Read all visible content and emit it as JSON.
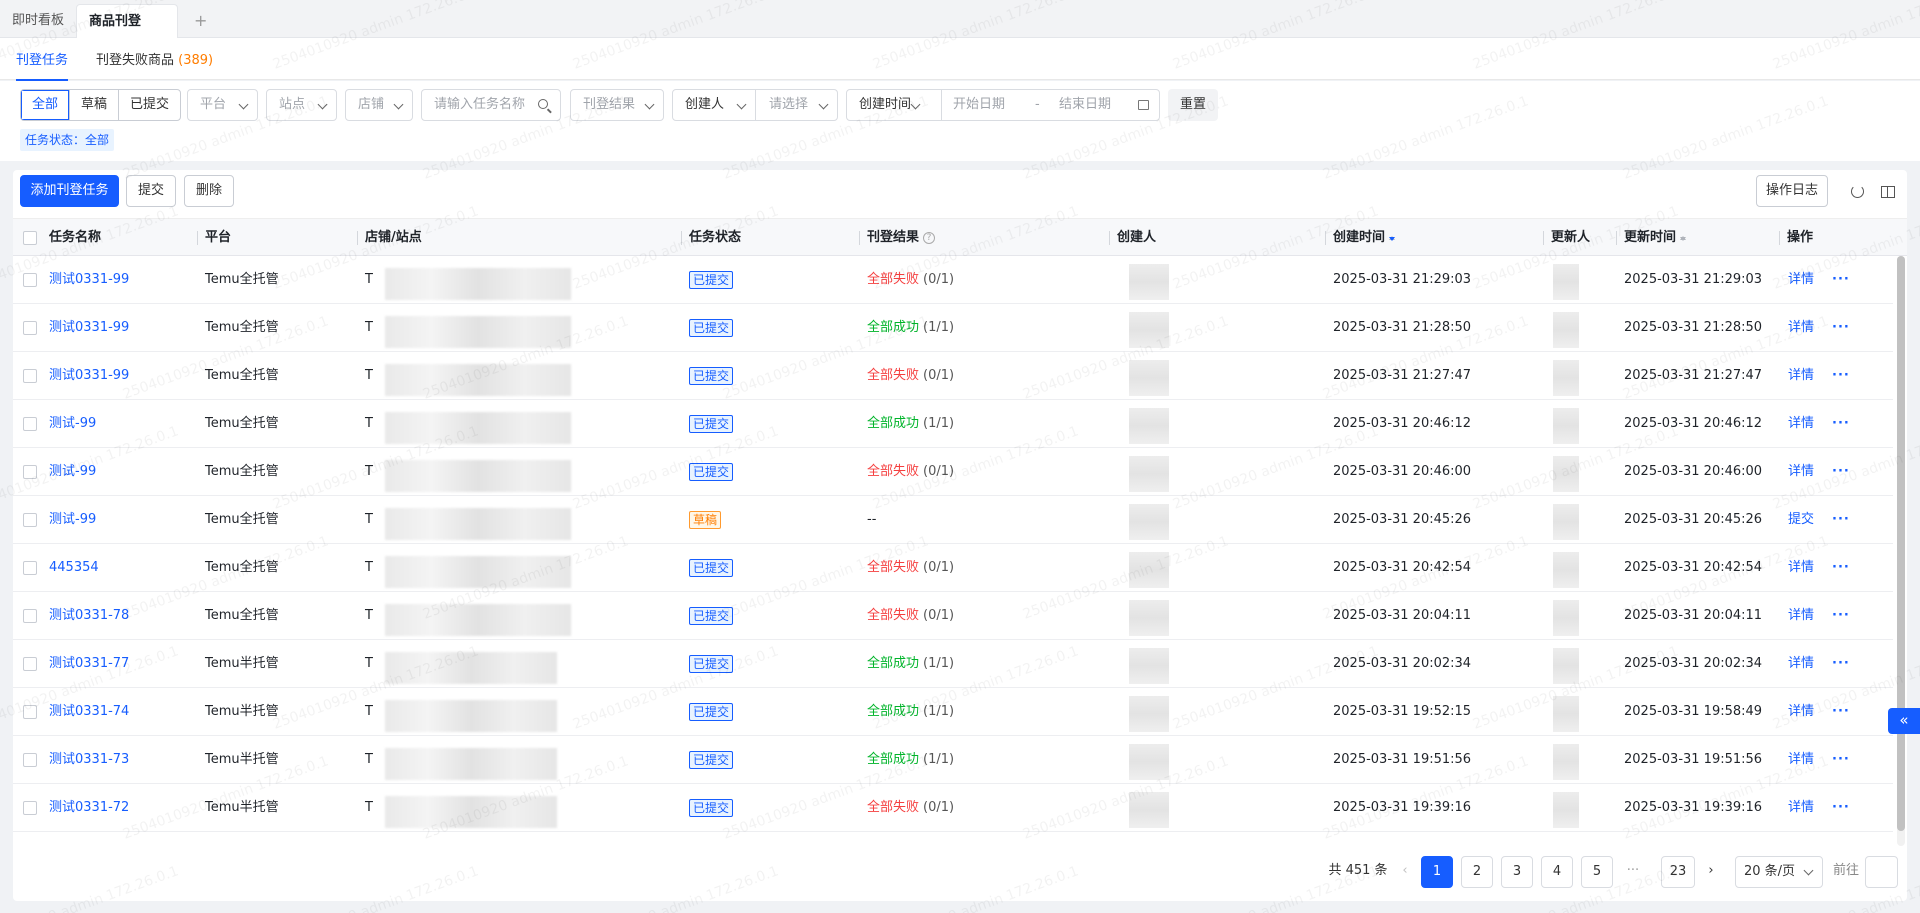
{
  "top_tabs": [
    "即时看板",
    "商品刊登",
    "+"
  ],
  "sub_tabs": {
    "tab1": "刊登任务",
    "tab2_label": "刊登失败商品",
    "tab2_count": "(389)"
  },
  "filters": {
    "segments": [
      "全部",
      "草稿",
      "已提交"
    ],
    "platform": "平台",
    "site": "站点",
    "store": "店铺",
    "search_placeholder": "请输入任务名称",
    "result": "刊登结果",
    "creator": "创建人",
    "creator_select": "请选择",
    "time_type": "创建时间",
    "start_date": "开始日期",
    "date_sep": "-",
    "end_date": "结束日期",
    "reset": "重置",
    "status_chip": "任务状态：全部"
  },
  "toolbar": {
    "add": "添加刊登任务",
    "submit": "提交",
    "delete": "删除",
    "log": "操作日志"
  },
  "columns": [
    "任务名称",
    "平台",
    "店铺/站点",
    "任务状态",
    "刊登结果",
    "创建人",
    "创建时间",
    "更新人",
    "更新时间",
    "操作"
  ],
  "rows": [
    {
      "name": "测试0331-99",
      "platform": "Temu全托管",
      "store": "T",
      "status": "已提交",
      "result": "全部失败",
      "count": "(0/1)",
      "created": "2025-03-31 21:29:03",
      "updated": "2025-03-31 21:29:03",
      "action": "详情"
    },
    {
      "name": "测试0331-99",
      "platform": "Temu全托管",
      "store": "T",
      "status": "已提交",
      "result": "全部成功",
      "count": "(1/1)",
      "created": "2025-03-31 21:28:50",
      "updated": "2025-03-31 21:28:50",
      "action": "详情"
    },
    {
      "name": "测试0331-99",
      "platform": "Temu全托管",
      "store": "T",
      "status": "已提交",
      "result": "全部失败",
      "count": "(0/1)",
      "created": "2025-03-31 21:27:47",
      "updated": "2025-03-31 21:27:47",
      "action": "详情"
    },
    {
      "name": "测试-99",
      "platform": "Temu全托管",
      "store": "T",
      "status": "已提交",
      "result": "全部成功",
      "count": "(1/1)",
      "created": "2025-03-31 20:46:12",
      "updated": "2025-03-31 20:46:12",
      "action": "详情"
    },
    {
      "name": "测试-99",
      "platform": "Temu全托管",
      "store": "T",
      "status": "已提交",
      "result": "全部失败",
      "count": "(0/1)",
      "created": "2025-03-31 20:46:00",
      "updated": "2025-03-31 20:46:00",
      "action": "详情"
    },
    {
      "name": "测试-99",
      "platform": "Temu全托管",
      "store": "T",
      "status": "草稿",
      "result": "--",
      "count": "",
      "created": "2025-03-31 20:45:26",
      "updated": "2025-03-31 20:45:26",
      "action": "提交"
    },
    {
      "name": "445354",
      "platform": "Temu全托管",
      "store": "T",
      "status": "已提交",
      "result": "全部失败",
      "count": "(0/1)",
      "created": "2025-03-31 20:42:54",
      "updated": "2025-03-31 20:42:54",
      "action": "详情"
    },
    {
      "name": "测试0331-78",
      "platform": "Temu全托管",
      "store": "T",
      "status": "已提交",
      "result": "全部失败",
      "count": "(0/1)",
      "created": "2025-03-31 20:04:11",
      "updated": "2025-03-31 20:04:11",
      "action": "详情"
    },
    {
      "name": "测试0331-77",
      "platform": "Temu半托管",
      "store": "T",
      "status": "已提交",
      "result": "全部成功",
      "count": "(1/1)",
      "created": "2025-03-31 20:02:34",
      "updated": "2025-03-31 20:02:34",
      "action": "详情"
    },
    {
      "name": "测试0331-74",
      "platform": "Temu半托管",
      "store": "T",
      "status": "已提交",
      "result": "全部成功",
      "count": "(1/1)",
      "created": "2025-03-31 19:52:15",
      "updated": "2025-03-31 19:58:49",
      "action": "详情"
    },
    {
      "name": "测试0331-73",
      "platform": "Temu半托管",
      "store": "T",
      "status": "已提交",
      "result": "全部成功",
      "count": "(1/1)",
      "created": "2025-03-31 19:51:56",
      "updated": "2025-03-31 19:51:56",
      "action": "详情"
    },
    {
      "name": "测试0331-72",
      "platform": "Temu半托管",
      "store": "T",
      "status": "已提交",
      "result": "全部失败",
      "count": "(0/1)",
      "created": "2025-03-31 19:39:16",
      "updated": "2025-03-31 19:39:16",
      "action": "详情"
    }
  ],
  "row_more": "···",
  "pagination": {
    "total": "共 451 条",
    "prev": "‹",
    "pages": [
      "1",
      "2",
      "3",
      "4",
      "5"
    ],
    "ellipsis": "···",
    "last": "23",
    "next": "›",
    "page_size": "20 条/页",
    "goto": "前往"
  },
  "collapse": "«",
  "watermark": "2504010920 admin 172.26.0.1",
  "colors": {
    "primary": "#165dff",
    "fail": "#f53f3f",
    "success": "#00b42a",
    "draft": "#ff7d00"
  }
}
